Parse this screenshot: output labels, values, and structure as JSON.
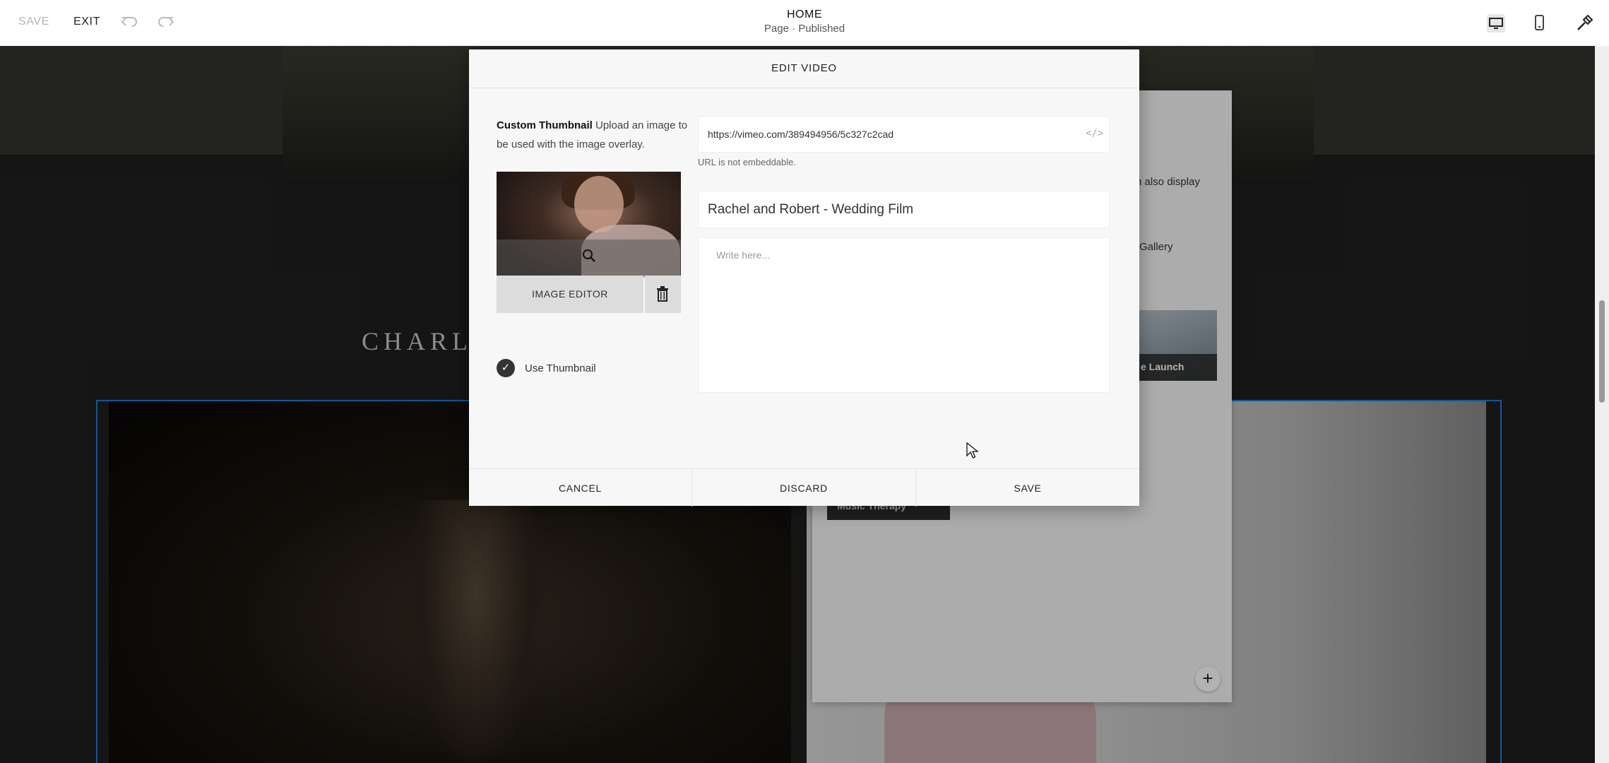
{
  "topbar": {
    "save_label": "SAVE",
    "exit_label": "EXIT",
    "page_title": "HOME",
    "page_status": "Page · Published",
    "icons": [
      "undo-icon",
      "redo-icon",
      "desktop-icon",
      "mobile-icon",
      "style-brush-icon"
    ]
  },
  "background": {
    "site_name_partial": "CHARLC",
    "panel_text_also": "n also display",
    "panel_text_gallery": "Gallery",
    "panel_tile_label": "e Launch",
    "panel_music_label": "Music Therapy"
  },
  "modal": {
    "title": "EDIT VIDEO",
    "thumbnail_heading": "Custom Thumbnail",
    "thumbnail_desc": "Upload an image to be used with the image overlay.",
    "image_editor_label": "IMAGE EDITOR",
    "use_thumbnail_label": "Use Thumbnail",
    "use_thumbnail_checked": true,
    "url_value": "https://vimeo.com/389494956/5c327c2cad",
    "embed_label": "</>",
    "url_error": "URL is not embeddable.",
    "title_value": "Rachel and Robert - Wedding Film",
    "description_placeholder": "Write here...",
    "description_value": "",
    "cancel_label": "CANCEL",
    "discard_label": "DISCARD",
    "save_label": "SAVE"
  },
  "colors": {
    "selection_outline": "#1f7cd9",
    "modal_bg": "#f7f7f7",
    "topbar_bg": "#ffffff"
  }
}
